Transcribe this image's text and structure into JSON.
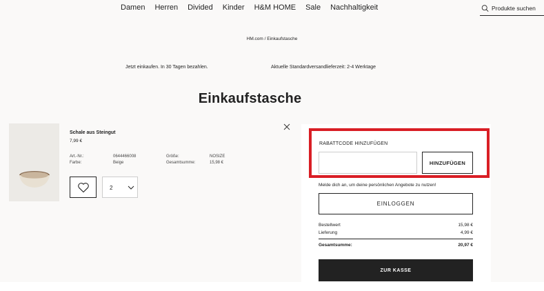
{
  "nav": {
    "items": [
      "Damen",
      "Herren",
      "Divided",
      "Kinder",
      "H&M HOME",
      "Sale",
      "Nachhaltigkeit"
    ],
    "search_placeholder": "Produkte suchen"
  },
  "breadcrumb": "HM.com / Einkaufstasche",
  "promo": {
    "left": "Jetzt einkaufen. In 30 Tagen bezahlen.",
    "right": "Aktuelle Standardversandlieferzeit: 2-4 Werktage"
  },
  "page_title": "Einkaufstasche",
  "product": {
    "name": "Schale aus Steingut",
    "price": "7,99 €",
    "art_label": "Art.-Nr.:",
    "art_value": "0644466008",
    "color_label": "Farbe:",
    "color_value": "Beige",
    "size_label": "Größe:",
    "size_value": "NOSIZE",
    "total_label": "Gesamtsumme:",
    "total_value": "15,98 €",
    "quantity": "2"
  },
  "coupon": {
    "label": "RABATTCODE HINZUFÜGEN",
    "input_value": "",
    "button": "HINZUFÜGEN"
  },
  "login": {
    "hint": "Melde dich an, um deine persönlichen Angebote zu nutzen!",
    "button": "EINLOGGEN"
  },
  "summary": {
    "order_label": "Bestellwert",
    "order_value": "15,98 €",
    "delivery_label": "Lieferung",
    "delivery_value": "4,99 €",
    "total_label": "Gesamtsumme:",
    "total_value": "20,97 €"
  },
  "checkout_button": "ZUR KASSE",
  "colors": {
    "highlight": "#d91e25",
    "checkout_bg": "#222222",
    "page_bg": "#faf9f8"
  }
}
